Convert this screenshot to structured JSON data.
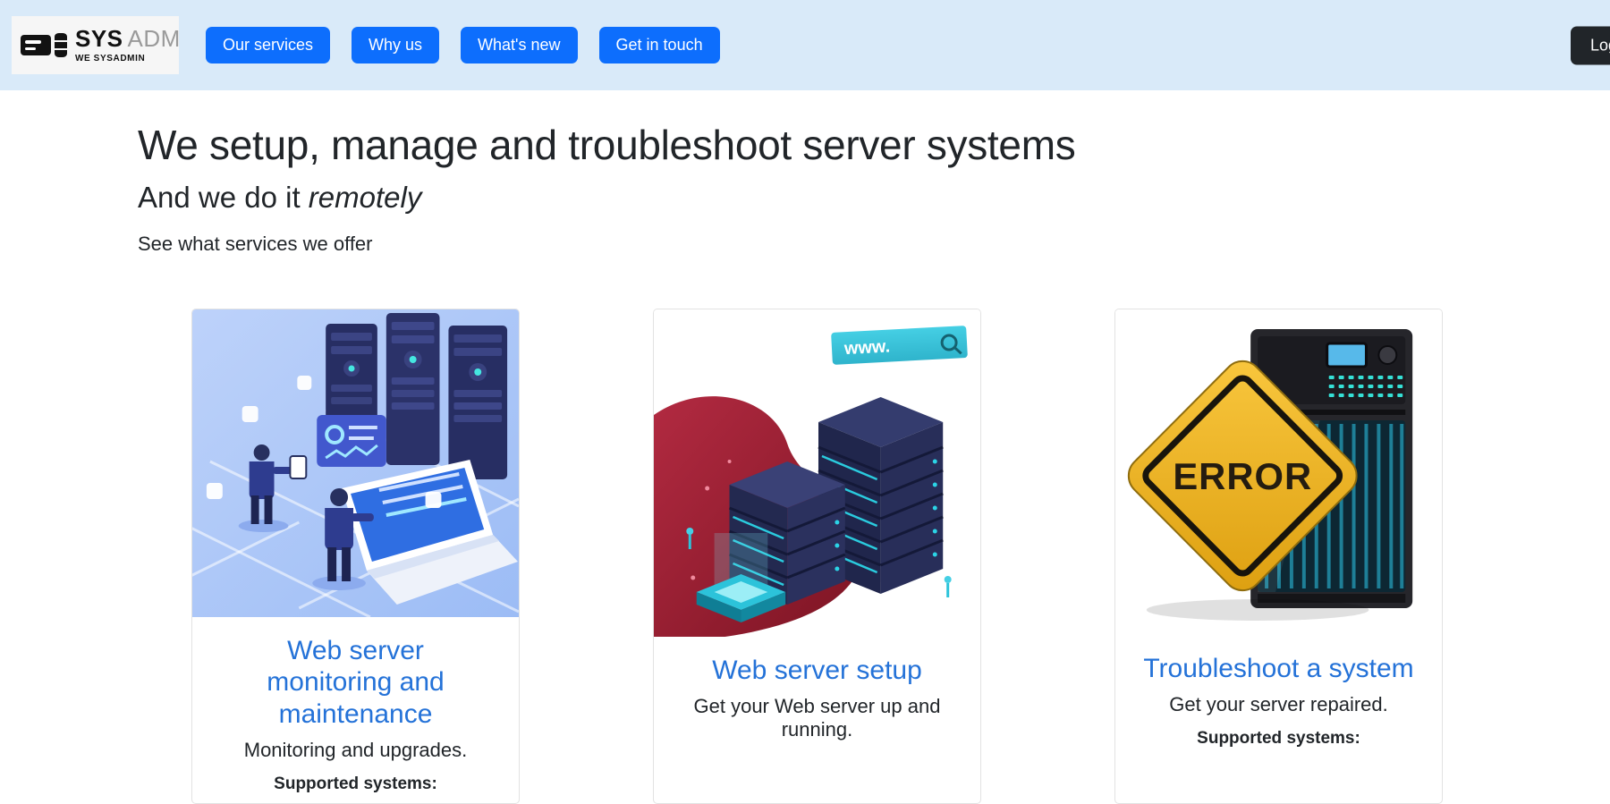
{
  "colors": {
    "navbar_bg": "#d9eaf9",
    "accent": "#0d6efd",
    "card_link_blue": "#2472d8",
    "login_bg": "#212529"
  },
  "navbar": {
    "logo": {
      "sys": "SYS",
      "adm": "ADM",
      "tagline": "WE SYSADMIN"
    },
    "links": [
      {
        "label": "Our services"
      },
      {
        "label": "Why us"
      },
      {
        "label": "What's new"
      },
      {
        "label": "Get in touch"
      }
    ],
    "login_label": "Login"
  },
  "hero": {
    "title": "We setup, manage and troubleshoot server systems",
    "subtitle_prefix": "And we do it ",
    "subtitle_emphasis": "remotely",
    "services_line": "See what services we offer"
  },
  "cards": [
    {
      "title": "Web server monitoring and maintenance",
      "description": "Monitoring and upgrades.",
      "footer": "Supported systems:"
    },
    {
      "title": "Web server setup",
      "description": "Get your Web server up and running.",
      "image_text": "www."
    },
    {
      "title": "Troubleshoot a system",
      "description": "Get your server repaired.",
      "footer": "Supported systems:",
      "image_text": "ERROR"
    }
  ]
}
